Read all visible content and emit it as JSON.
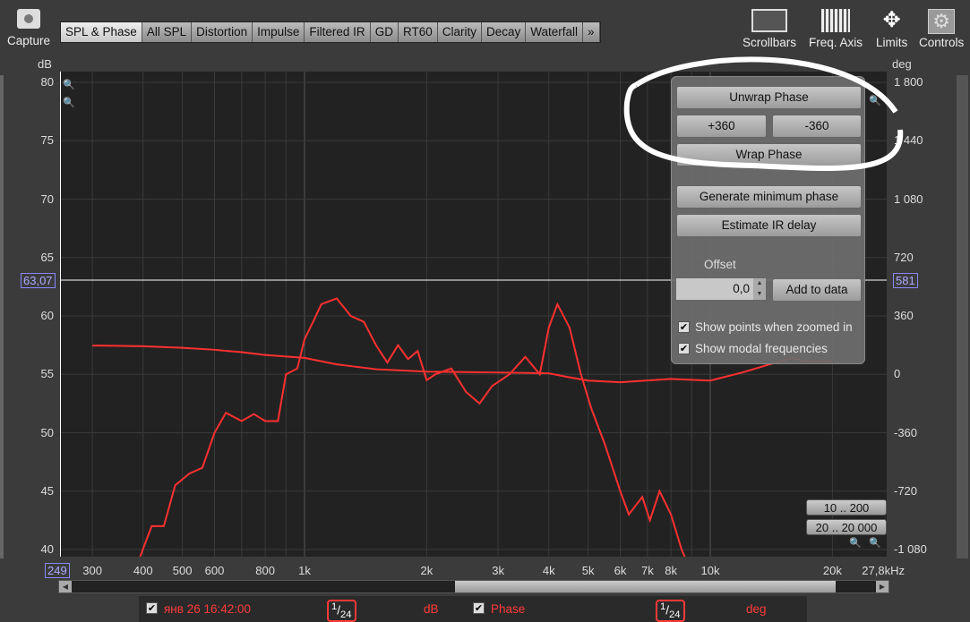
{
  "toolbar": {
    "capture": "Capture",
    "scrollbars": "Scrollbars",
    "freq_axis": "Freq. Axis",
    "limits": "Limits",
    "controls": "Controls"
  },
  "tabs": [
    "SPL & Phase",
    "All SPL",
    "Distortion",
    "Impulse",
    "Filtered IR",
    "GD",
    "RT60",
    "Clarity",
    "Decay",
    "Waterfall",
    "»"
  ],
  "axes": {
    "left_unit": "dB",
    "right_unit": "deg",
    "left_ticks": [
      "80",
      "75",
      "70",
      "65",
      "60",
      "55",
      "50",
      "45",
      "40"
    ],
    "right_ticks": [
      "1 800",
      "1 440",
      "1 080",
      "720",
      "360",
      "0",
      "-360",
      "-720",
      "-1 080"
    ],
    "x_ticks": [
      "300",
      "400",
      "500",
      "600",
      "800",
      "1k",
      "2k",
      "3k",
      "4k",
      "5k",
      "6k",
      "7k",
      "8k",
      "10k",
      "20k",
      "27,8kHz"
    ],
    "cursor_db": "63,07",
    "cursor_deg": "581",
    "cursor_freq": "249"
  },
  "panel": {
    "unwrap": "Unwrap Phase",
    "plus360": "+360",
    "minus360": "-360",
    "wrap": "Wrap Phase",
    "genmin": "Generate minimum phase",
    "estimate": "Estimate IR delay",
    "offset_label": "Offset",
    "offset_value": "0,0",
    "add": "Add to data",
    "show_points": "Show points when zoomed in",
    "show_modal": "Show modal frequencies"
  },
  "range_buttons": [
    "10 .. 200",
    "20 .. 20 000"
  ],
  "legend": {
    "measurement": "янв 26 16:42:00",
    "smoothing1_num": "1",
    "smoothing1_den": "24",
    "unit1": "dB",
    "phase": "Phase",
    "smoothing2_num": "1",
    "smoothing2_den": "24",
    "unit2": "deg"
  },
  "colors": {
    "curve": "#ff3030",
    "bg": "#222222"
  },
  "spl": [
    [
      380,
      38
    ],
    [
      420,
      42
    ],
    [
      450,
      42
    ],
    [
      480,
      45.5
    ],
    [
      520,
      46.5
    ],
    [
      560,
      47
    ],
    [
      600,
      50
    ],
    [
      640,
      51.7
    ],
    [
      700,
      51
    ],
    [
      750,
      51.6
    ],
    [
      800,
      51
    ],
    [
      860,
      51
    ],
    [
      900,
      55
    ],
    [
      960,
      55.5
    ],
    [
      1000,
      58
    ],
    [
      1050,
      59.5
    ],
    [
      1100,
      61
    ],
    [
      1200,
      61.5
    ],
    [
      1300,
      60
    ],
    [
      1400,
      59.5
    ],
    [
      1500,
      57.5
    ],
    [
      1600,
      56
    ],
    [
      1700,
      57.5
    ],
    [
      1800,
      56.3
    ],
    [
      1900,
      57
    ],
    [
      2000,
      54.5
    ],
    [
      2100,
      55
    ],
    [
      2300,
      55.5
    ],
    [
      2500,
      53.5
    ],
    [
      2700,
      52.5
    ],
    [
      2900,
      54
    ],
    [
      3200,
      55
    ],
    [
      3500,
      56.5
    ],
    [
      3800,
      55
    ],
    [
      4000,
      59
    ],
    [
      4200,
      61
    ],
    [
      4500,
      59
    ],
    [
      4800,
      55
    ],
    [
      5100,
      52
    ],
    [
      5500,
      49
    ],
    [
      6000,
      45
    ],
    [
      6300,
      43
    ],
    [
      6800,
      44.5
    ],
    [
      7100,
      42.5
    ],
    [
      7500,
      45
    ],
    [
      8000,
      43
    ],
    [
      8500,
      40
    ],
    [
      9000,
      38
    ]
  ],
  "phase": [
    [
      300,
      176
    ],
    [
      400,
      172
    ],
    [
      500,
      162
    ],
    [
      600,
      150
    ],
    [
      700,
      135
    ],
    [
      800,
      118
    ],
    [
      1000,
      100
    ],
    [
      1200,
      60
    ],
    [
      1500,
      30
    ],
    [
      2000,
      15
    ],
    [
      3000,
      10
    ],
    [
      4000,
      5
    ],
    [
      4500,
      -20
    ],
    [
      5000,
      -40
    ],
    [
      6000,
      -50
    ],
    [
      8000,
      -30
    ],
    [
      10000,
      -40
    ],
    [
      12000,
      10
    ],
    [
      14000,
      60
    ],
    [
      16000,
      100
    ],
    [
      17000,
      80
    ],
    [
      20000,
      80
    ]
  ]
}
